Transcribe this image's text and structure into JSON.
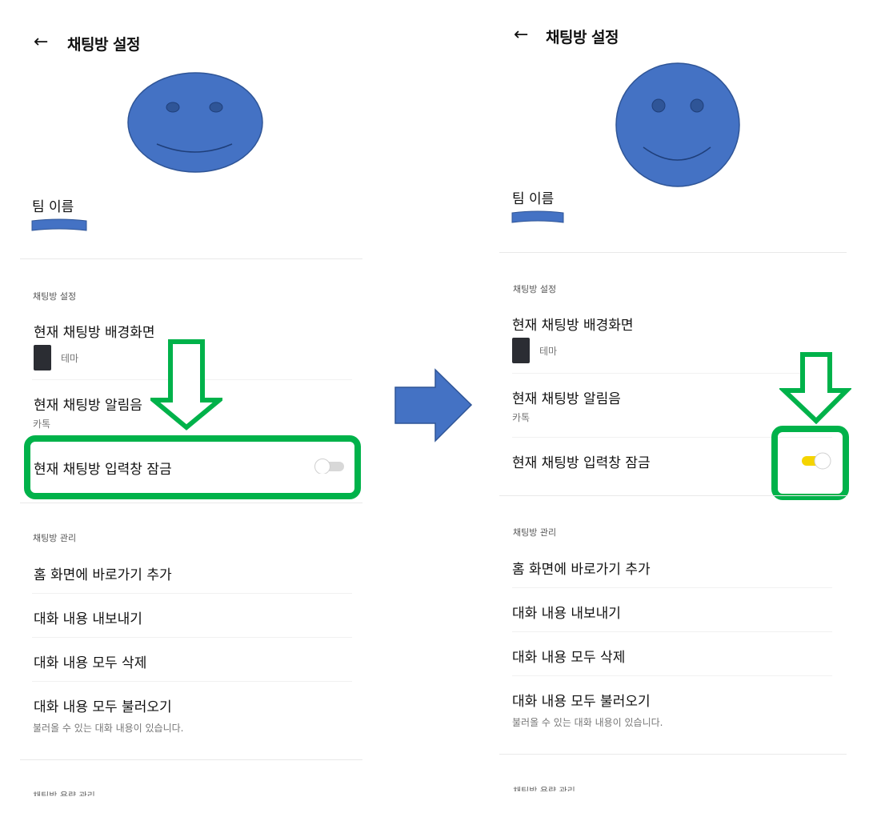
{
  "left": {
    "header": {
      "back_icon": "arrow-left-icon",
      "title": "채팅방 설정"
    },
    "team_name_label": "팀 이름",
    "section_chat_settings": "채팅방 설정",
    "background": {
      "label": "현재 채팅방 배경화면",
      "value": "테마"
    },
    "notification": {
      "label": "현재 채팅방 알림음",
      "value": "카톡"
    },
    "input_lock": {
      "label": "현재 채팅방 입력창 잠금",
      "enabled": false
    },
    "section_manage": "채팅방 관리",
    "items": [
      {
        "label": "홈 화면에 바로가기 추가"
      },
      {
        "label": "대화 내용 내보내기"
      },
      {
        "label": "대화 내용 모두 삭제"
      },
      {
        "label": "대화 내용 모두 불러오기",
        "sub": "불러올 수 있는 대화 내용이 있습니다."
      }
    ],
    "section_cutoff": "채팅방 용량 관리"
  },
  "right": {
    "header": {
      "back_icon": "arrow-left-icon",
      "title": "채팅방 설정"
    },
    "team_name_label": "팀 이름",
    "section_chat_settings": "채팅방 설정",
    "background": {
      "label": "현재 채팅방 배경화면",
      "value": "테마"
    },
    "notification": {
      "label": "현재 채팅방 알림음",
      "value": "카톡"
    },
    "input_lock": {
      "label": "현재 채팅방 입력창 잠금",
      "enabled": true
    },
    "section_manage": "채팅방 관리",
    "items": [
      {
        "label": "홈 화면에 바로가기 추가"
      },
      {
        "label": "대화 내용 내보내기"
      },
      {
        "label": "대화 내용 모두 삭제"
      },
      {
        "label": "대화 내용 모두 불러오기",
        "sub": "불러올 수 있는 대화 내용이 있습니다."
      }
    ],
    "section_cutoff": "채팅방 용량 관리"
  },
  "colors": {
    "highlight_green": "#00b24a",
    "smiley_blue": "#4472c4",
    "toggle_on": "#f5d400",
    "transition_arrow": "#4472c4"
  }
}
